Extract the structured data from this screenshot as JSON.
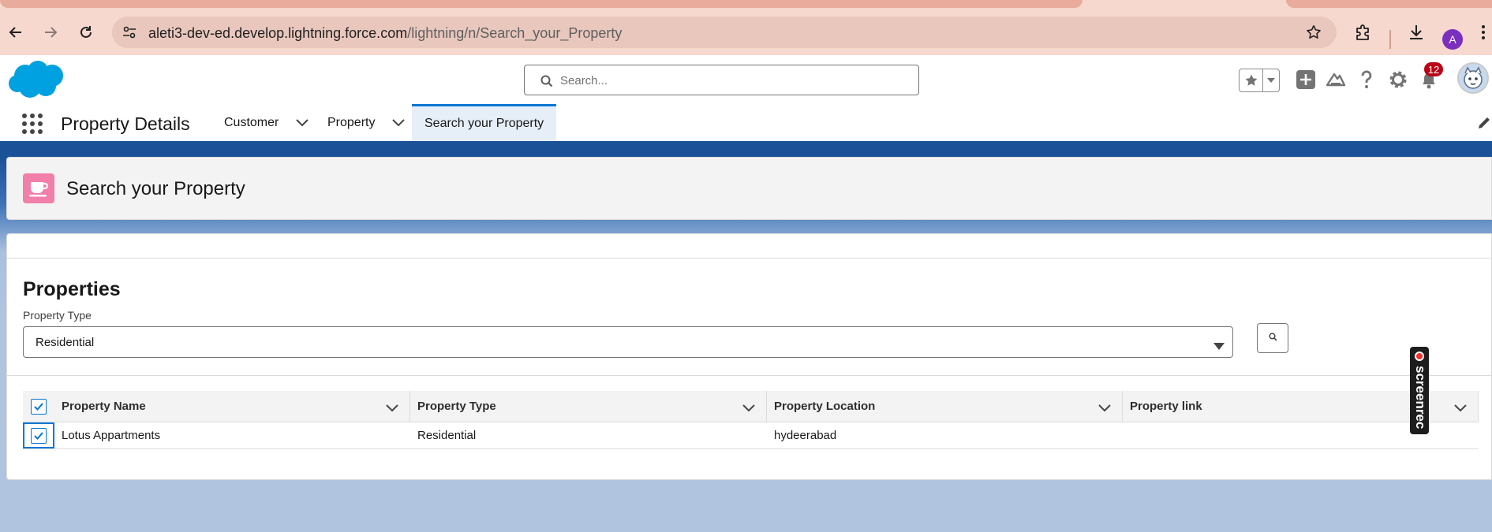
{
  "browser": {
    "url_host": "aleti3-dev-ed.develop.lightning.force.com",
    "url_path": "/lightning/n/Search_your_Property",
    "profile_initial": "A",
    "icons": [
      "back-icon",
      "forward-icon",
      "reload-icon",
      "site-info-icon",
      "bookmark-star-icon",
      "extensions-icon",
      "download-icon",
      "kebab-menu-icon"
    ]
  },
  "header": {
    "search_placeholder": "Search...",
    "notification_count": "12",
    "icons": [
      "salesforce-cloud-logo",
      "favorites-star-icon",
      "favorites-dropdown-icon",
      "global-actions-plus-icon",
      "trailhead-icon",
      "help-icon",
      "setup-gear-icon",
      "notifications-bell-icon",
      "user-avatar"
    ]
  },
  "nav": {
    "app_name": "Property Details",
    "items": [
      {
        "label": "Customer",
        "active": false
      },
      {
        "label": "Property",
        "active": false
      },
      {
        "label": "Search your Property",
        "active": true
      }
    ]
  },
  "page_header": {
    "title": "Search your Property",
    "icon": "cup-icon",
    "icon_color": "#f27eaa"
  },
  "card": {
    "title": "Properties",
    "field_label": "Property Type",
    "selected_value": "Residential",
    "search_button_icon": "search-icon"
  },
  "table": {
    "columns": [
      "Property Name",
      "Property Type",
      "Property Location",
      "Property link"
    ],
    "rows": [
      {
        "checked": true,
        "cells": [
          "Lotus Appartments",
          "Residential",
          "hydeerabad",
          ""
        ]
      }
    ]
  },
  "overlay": {
    "label": "screenrec"
  },
  "colors": {
    "brand_blue": "#0176d3",
    "band_blue": "#1b5297",
    "browser_chrome": "#f6d8cf",
    "notification_red": "#ba0517"
  }
}
